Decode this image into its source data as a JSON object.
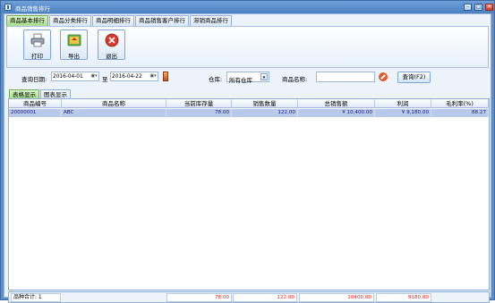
{
  "window": {
    "title": "商品销售排行"
  },
  "top_tabs": [
    "商品基本排行",
    "商品分类排行",
    "商品明细排行",
    "商品销售客户排行",
    "滞销商品排行"
  ],
  "toolbar": {
    "print_label": "打印",
    "export_label": "导出",
    "exit_label": "退出"
  },
  "filter": {
    "date_label": "查询日期:",
    "date_from": "2016-04-01",
    "to_label": "至",
    "date_to": "2016-04-22",
    "warehouse_label": "仓库:",
    "warehouse_value": "所有仓库",
    "product_name_label": "商品名称:",
    "product_name_value": "",
    "query_button": "查询(F2)"
  },
  "view_tabs": [
    "表格显示",
    "图表显示"
  ],
  "table": {
    "columns": [
      "商品编号",
      "商品名称",
      "当前库存量",
      "销售数量",
      "总销售额",
      "利润",
      "毛利率(%)"
    ],
    "rows": [
      [
        "20000001",
        "ABC",
        "78.00",
        "122.00",
        "¥ 10,400.00",
        "¥ 9,180.00",
        "88.27"
      ]
    ]
  },
  "footer": {
    "count_label": "品种合计: 1",
    "stock_total": "78.00",
    "qty_total": "122.00",
    "sales_total": "10400.00",
    "profit_total": "9180.00"
  },
  "colors": {
    "title_bar": "#4b7fc0",
    "active_tab": "#a6dd8a",
    "selected_row": "#b9c9ea",
    "total_text": "#e02020"
  }
}
